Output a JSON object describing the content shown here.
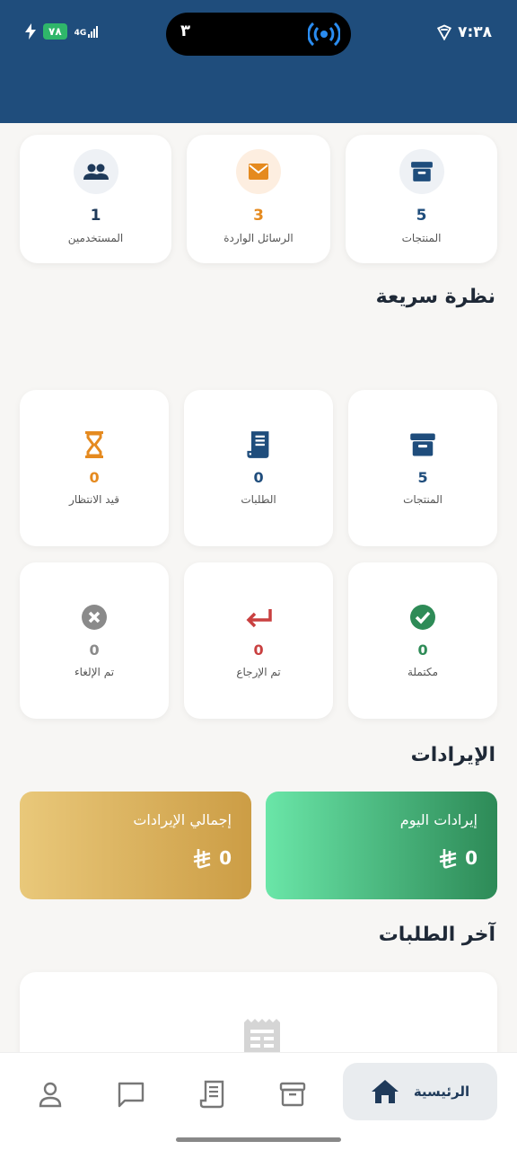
{
  "status": {
    "time": "٧:٣٨",
    "battery": "٧٨",
    "network": "4G",
    "island_number": "٣"
  },
  "top_stats": [
    {
      "label": "المنتجات",
      "value": "5",
      "color": "#1f4d7c",
      "icon": "archive-icon"
    },
    {
      "label": "الرسائل الواردة",
      "value": "3",
      "color": "#e58a1f",
      "icon": "mail-icon"
    },
    {
      "label": "المستخدمين",
      "value": "1",
      "color": "#1f3a5a",
      "icon": "users-icon"
    }
  ],
  "overview": {
    "title": "نظرة سريعة",
    "cards": [
      {
        "label": "المنتجات",
        "value": "5",
        "color": "#1f4d7c",
        "icon": "archive-icon"
      },
      {
        "label": "الطلبات",
        "value": "0",
        "color": "#1f4d7c",
        "icon": "receipt-icon"
      },
      {
        "label": "قيد الانتظار",
        "value": "0",
        "color": "#e58a1f",
        "icon": "hourglass-icon"
      },
      {
        "label": "مكتملة",
        "value": "0",
        "color": "#2e8b57",
        "icon": "check-circle-icon"
      },
      {
        "label": "تم الإرجاع",
        "value": "0",
        "color": "#c94040",
        "icon": "return-icon"
      },
      {
        "label": "تم الإلغاء",
        "value": "0",
        "color": "#8a8a8a",
        "icon": "cancel-circle-icon"
      }
    ]
  },
  "revenue": {
    "title": "الإيرادات",
    "today_label": "إيرادات اليوم",
    "today_value": "0",
    "total_label": "إجمالي الإيرادات",
    "total_value": "0",
    "currency_icon": "riyal-icon"
  },
  "latest_orders": {
    "title": "آخر الطلبات"
  },
  "nav": {
    "home_label": "الرئيسية",
    "accent": "#1f3a5a"
  }
}
